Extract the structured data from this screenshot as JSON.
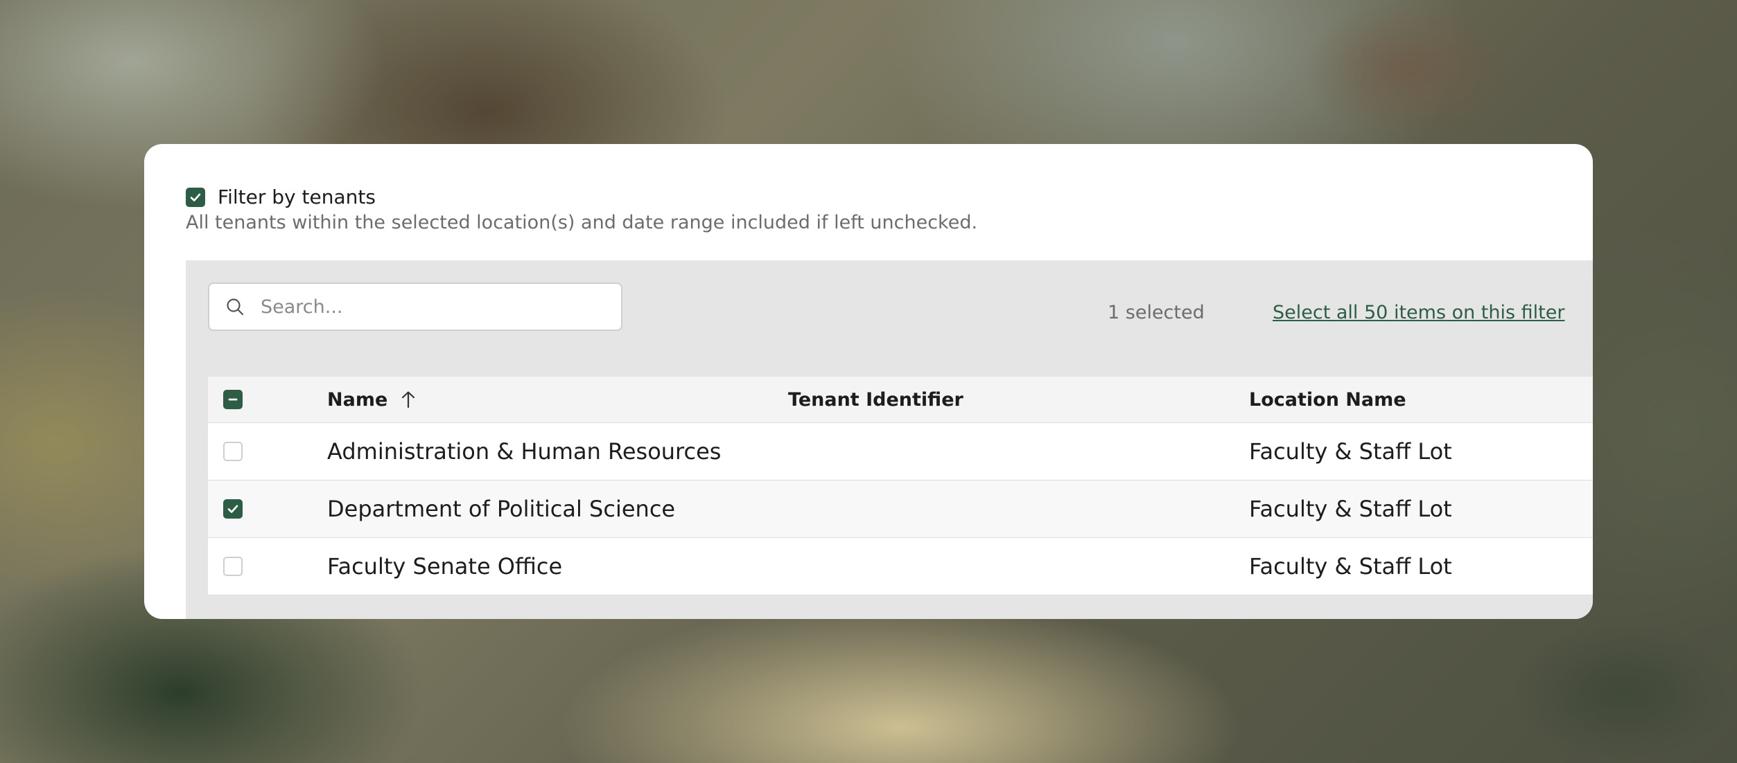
{
  "filter": {
    "label": "Filter by tenants",
    "checked": true,
    "description": "All tenants within the selected location(s) and date range included if left unchecked."
  },
  "search": {
    "placeholder": "Search...",
    "value": ""
  },
  "selection": {
    "count_text": "1 selected",
    "select_all_text": "Select all 50 items on this filter"
  },
  "table": {
    "columns": [
      "Name",
      "Tenant Identifier",
      "Location Name"
    ],
    "sort": {
      "column": "Name",
      "direction": "ascending"
    },
    "rows": [
      {
        "name": "Administration & Human Resources",
        "tenant_identifier": "",
        "location": "Faculty & Staff Lot",
        "checked": false
      },
      {
        "name": "Department of Political Science",
        "tenant_identifier": "",
        "location": "Faculty & Staff Lot",
        "checked": true
      },
      {
        "name": "Faculty Senate Office",
        "tenant_identifier": "",
        "location": "Faculty & Staff Lot",
        "checked": false
      }
    ]
  },
  "colors": {
    "accent": "#2d5e45",
    "panel_bg": "#e5e5e5",
    "muted_text": "#6c6c6c"
  },
  "icons": {
    "search": "search-icon",
    "sort": "arrow-up-icon",
    "check": "checkmark-icon",
    "indeterminate": "minus-icon"
  }
}
